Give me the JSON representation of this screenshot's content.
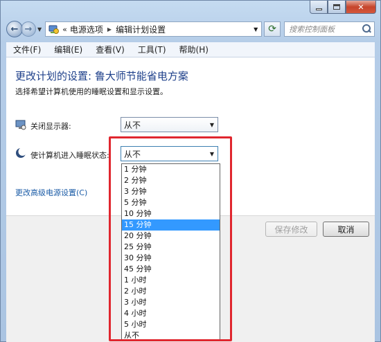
{
  "nav": {
    "breadcrumb": [
      "电源选项",
      "编辑计划设置"
    ],
    "search_placeholder": "搜索控制面板"
  },
  "menu": [
    "文件(F)",
    "编辑(E)",
    "查看(V)",
    "工具(T)",
    "帮助(H)"
  ],
  "content": {
    "title": "更改计划的设置: 鲁大师节能省电方案",
    "subtitle": "选择希望计算机使用的睡眠设置和显示设置。",
    "display_label": "关闭显示器:",
    "display_value": "从不",
    "sleep_label": "使计算机进入睡眠状态:",
    "sleep_value": "从不",
    "advanced_link": "更改高级电源设置(C)"
  },
  "buttons": {
    "save": "保存修改",
    "cancel": "取消"
  },
  "dropdown": {
    "options": [
      "1 分钟",
      "2 分钟",
      "3 分钟",
      "5 分钟",
      "10 分钟",
      "15 分钟",
      "20 分钟",
      "25 分钟",
      "30 分钟",
      "45 分钟",
      "1 小时",
      "2 小时",
      "3 小时",
      "4 小时",
      "5 小时",
      "从不"
    ],
    "highlighted": "15 分钟"
  },
  "colors": {
    "title": "#1d3f8a",
    "link": "#1a5ba6",
    "selection": "#3399ff",
    "annotation": "#e0262e"
  }
}
